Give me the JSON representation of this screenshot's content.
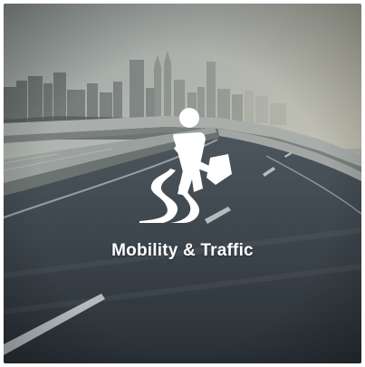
{
  "tile": {
    "title": "Mobility & Traffic",
    "icon": "road-traffic-worker-icon"
  },
  "colors": {
    "text": "#ffffff",
    "sky": "#d7dcd6",
    "road": "#3d454b",
    "icon": "#ffffff"
  }
}
